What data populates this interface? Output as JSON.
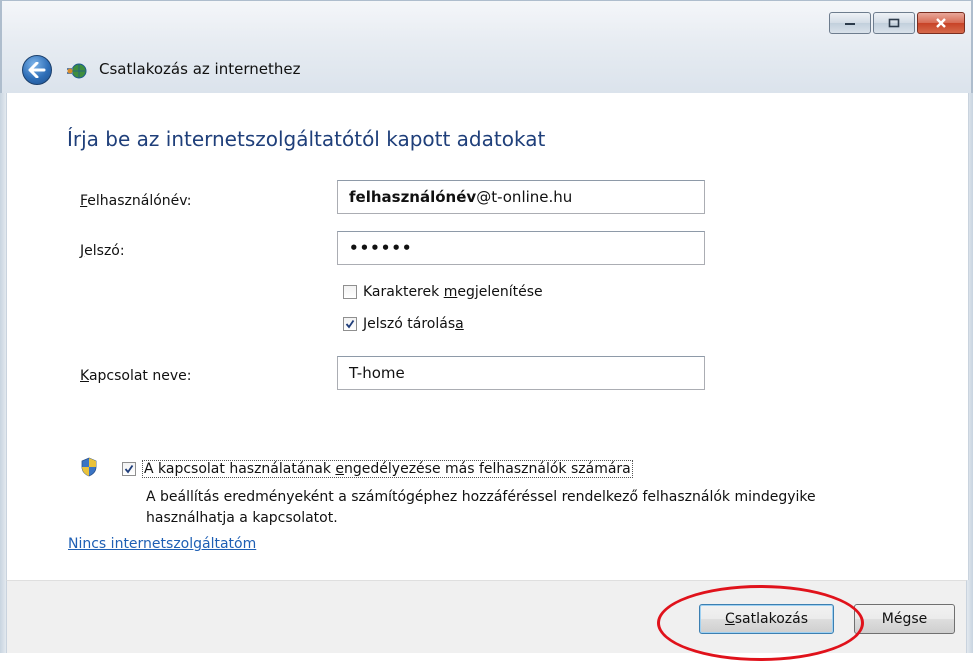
{
  "window": {
    "title": "Csatlakozás az internethez",
    "controls": {
      "minimize": "minimize-icon",
      "maximize": "maximize-icon",
      "close": "close-icon"
    }
  },
  "main": {
    "heading": "Írja be az internetszolgáltatótól kapott adatokat",
    "username": {
      "label_accel": "F",
      "label_rest": "elhasználónév:",
      "value_bold": "felhasználónév",
      "value_rest": "@t-online.hu"
    },
    "password": {
      "label_accel": "J",
      "label_rest": "elszó:",
      "value": "••••••"
    },
    "show_chars": {
      "checked": false,
      "label_pre": "Karakterek ",
      "label_accel": "m",
      "label_post": "egjelenítése"
    },
    "remember": {
      "checked": true,
      "label_pre": "Jelszó tárolás",
      "label_accel": "a",
      "label_post": ""
    },
    "connection_name": {
      "label_accel": "K",
      "label_rest": "apcsolat neve:",
      "value": "T-home"
    },
    "allow_others": {
      "checked": true,
      "label_pre": "A kapcsolat használatának ",
      "label_accel": "e",
      "label_post": "ngedélyezése más felhasználók számára",
      "description_line1": "A beállítás eredményeként a számítógéphez hozzáféréssel rendelkező felhasználók mindegyike",
      "description_line2": "használhatja a kapcsolatot."
    },
    "no_isp_link": "Nincs internetszolgáltatóm"
  },
  "footer": {
    "connect": {
      "accel": "C",
      "rest": "satlakozás"
    },
    "cancel": "Mégse"
  },
  "colors": {
    "heading": "#1f3f7a",
    "link": "#1e5fb4",
    "annotation": "#e0121b"
  }
}
